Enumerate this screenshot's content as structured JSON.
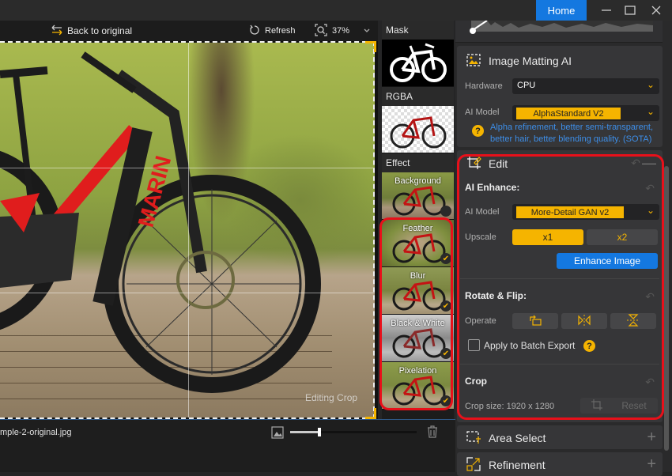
{
  "titlebar": {
    "home_label": "Home",
    "minimize_icon": "minimize-icon",
    "maximize_icon": "maximize-icon",
    "close_icon": "close-icon"
  },
  "canvas_toolbar": {
    "back_label": "Back to original",
    "refresh_label": "Refresh",
    "zoom_value": "37%"
  },
  "canvas": {
    "overlay_label": "Editing Crop"
  },
  "thumbnails": {
    "mask_label": "Mask",
    "rgba_label": "RGBA",
    "effect_label": "Effect",
    "effects": [
      {
        "name": "Background",
        "checked": false
      },
      {
        "name": "Feather",
        "checked": true
      },
      {
        "name": "Blur",
        "checked": true
      },
      {
        "name": "Black & White",
        "checked": true
      },
      {
        "name": "Pixelation",
        "checked": true
      }
    ]
  },
  "bottom_bar": {
    "filename": "mple-2-original.jpg",
    "thumb_size_fraction": 0.23
  },
  "panel": {
    "matting": {
      "title": "Image Matting AI",
      "hardware_label": "Hardware",
      "hardware_value": "CPU",
      "model_label": "AI Model",
      "model_value": "AlphaStandard  V2",
      "description_line1": "Alpha refinement, better semi-transparent,",
      "description_line2": "better hair, better blending quality. (SOTA)"
    },
    "edit": {
      "title": "Edit",
      "ai_enhance": {
        "title": "AI Enhance:",
        "model_label": "AI Model",
        "model_value": "More-Detail GAN v2",
        "upscale_label": "Upscale",
        "upscale_options": [
          "x1",
          "x2"
        ],
        "upscale_selected": "x1",
        "enhance_button": "Enhance Image"
      },
      "rotate_flip": {
        "title": "Rotate & Flip:",
        "operate_label": "Operate",
        "batch_label": "Apply to Batch Export",
        "batch_checked": false
      },
      "crop": {
        "title": "Crop",
        "size_text": "Crop size: 1920 x 1280",
        "reset_label": "Reset"
      }
    },
    "area_select": {
      "title": "Area Select"
    },
    "refinement": {
      "title": "Refinement"
    }
  },
  "colors": {
    "accent_blue": "#1478e0",
    "accent_yellow": "#f5b400",
    "highlight_red": "#e8101a",
    "panel_bg": "#2a2a2b"
  }
}
